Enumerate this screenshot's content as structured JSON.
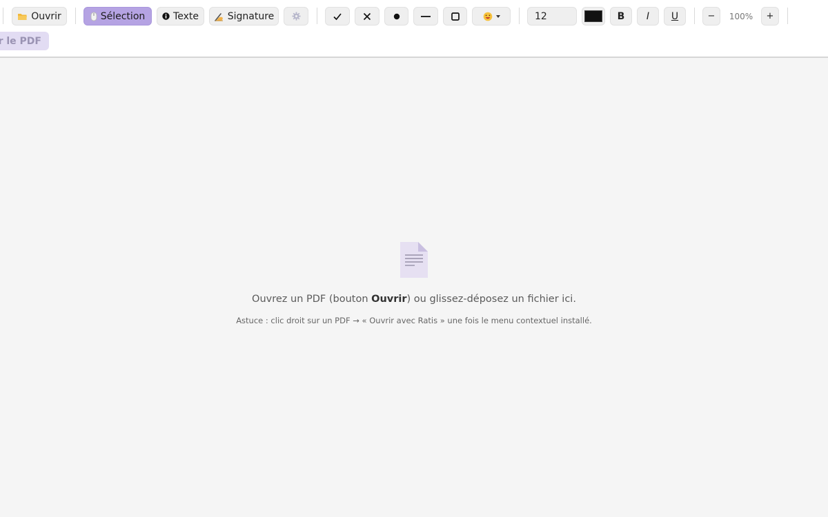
{
  "toolbar": {
    "open_label": "Ouvrir",
    "select_label": "Sélection",
    "text_label": "Texte",
    "signature_label": "Signature",
    "font_size": "12",
    "text_color": "#111111",
    "bold_label": "B",
    "italic_label": "I",
    "underline_label": "U",
    "zoom_out_label": "−",
    "zoom_level": "100%",
    "zoom_in_label": "+",
    "export_label": "ter le PDF"
  },
  "icons": {
    "open": "folder-icon",
    "select": "mouse-icon",
    "text": "info-icon",
    "signature": "writing-hand-icon",
    "settings": "gear-icon",
    "check": "check-icon",
    "cross": "cross-icon",
    "dot": "dot-icon",
    "line": "line-icon",
    "rect": "rectangle-icon",
    "emoji": "emoji-icon",
    "document": "document-icon"
  },
  "empty_state": {
    "msg_before": "Ouvrez un PDF (bouton ",
    "msg_strong": "Ouvrir",
    "msg_after": ") ou glissez-déposez un fichier ici.",
    "tip": "Astuce : clic droit sur un PDF → « Ouvrir avec Ratis » une fois le menu contextuel installé."
  },
  "colors": {
    "accent": "#b5a3e3",
    "background": "#f5f5f5"
  }
}
